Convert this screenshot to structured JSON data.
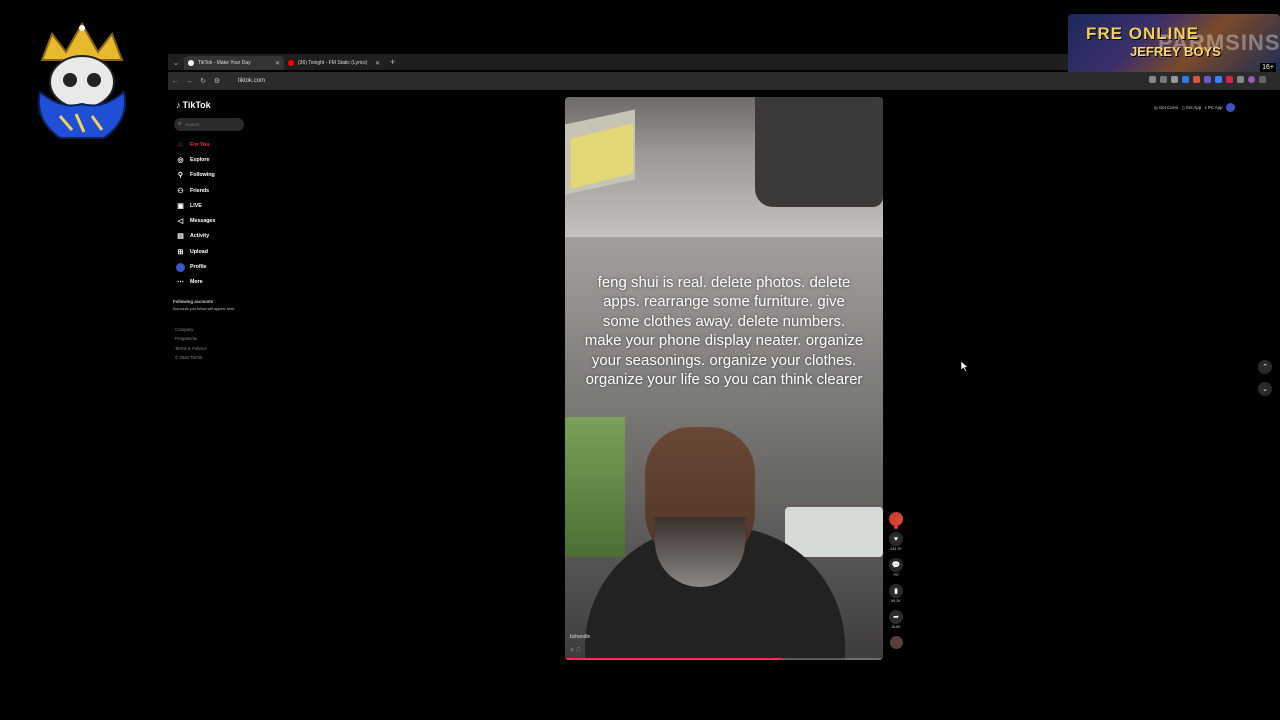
{
  "browser": {
    "tabs": [
      {
        "label": "TikTok - Make Your Day",
        "active": true,
        "favicon_color": "#ffffff"
      },
      {
        "label": "(36) Tonight - FM Static (Lyrics)",
        "active": false,
        "favicon_color": "#ff0000"
      }
    ],
    "url": "tiktok.com"
  },
  "banner": {
    "line1": "FRE ONLINE",
    "line2": "JEFREY BOYS",
    "overlay": "PARMSINS",
    "badge": "16+"
  },
  "tiktok": {
    "logo": "TikTok",
    "search_placeholder": "Search",
    "menu": [
      {
        "label": "For You",
        "icon": "home-icon",
        "glyph": "⌂",
        "active": true
      },
      {
        "label": "Explore",
        "icon": "compass-icon",
        "glyph": "◎",
        "active": false
      },
      {
        "label": "Following",
        "icon": "following-icon",
        "glyph": "⚲",
        "active": false
      },
      {
        "label": "Friends",
        "icon": "friends-icon",
        "glyph": "⚇",
        "active": false
      },
      {
        "label": "LIVE",
        "icon": "live-icon",
        "glyph": "▣",
        "active": false
      },
      {
        "label": "Messages",
        "icon": "messages-icon",
        "glyph": "◁",
        "active": false
      },
      {
        "label": "Activity",
        "icon": "activity-icon",
        "glyph": "▤",
        "active": false
      },
      {
        "label": "Upload",
        "icon": "upload-icon",
        "glyph": "⊞",
        "active": false
      },
      {
        "label": "Profile",
        "icon": "profile-icon",
        "glyph": "●",
        "active": false
      },
      {
        "label": "More",
        "icon": "more-icon",
        "glyph": "⋯",
        "active": false
      }
    ],
    "following_heading": "Following accounts",
    "following_sub": "Accounts you follow will appear here",
    "footer": [
      "Company",
      "Programme",
      "Terms & Policies",
      "© 2026 TikTok"
    ],
    "top_links": [
      "Get Coins",
      "Get App",
      "PC App"
    ],
    "accent": "#fe2c55"
  },
  "video": {
    "caption": "feng shui is real. delete photos. delete apps. rearrange some furniture. give some clothes away. delete numbers. make your phone display neater. organize your seasonings. organize your clothes. organize your life so you can think clearer",
    "username": "bzhandle",
    "music": "♫ 🎵",
    "progress": 0.68
  },
  "rail": {
    "likes": "434.7K",
    "comments": "797",
    "saves": "69.2K",
    "shares": "16.8K"
  }
}
